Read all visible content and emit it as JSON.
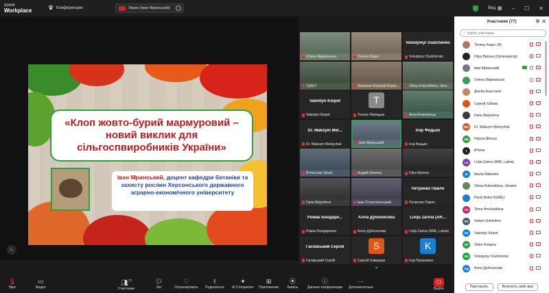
{
  "titlebar": {
    "logo_line1": "zoom",
    "logo_line2": "Workplace",
    "meeting_label": "Конференции",
    "share_label": "Экран (Іван Мринський)",
    "view_label": "Вид"
  },
  "slide": {
    "title": "«Клоп жовто-бурий мармуровий – новий виклик для сільгоспвиробників України»",
    "author_name": "Іван Мринський",
    "author_rest": ", доцент кафедри ботаніки та захисту рослин Херсонського державного аграрно-економічного університету"
  },
  "gallery": [
    {
      "big": "",
      "name": "Олена Марковська",
      "bg": "#6b7e6a"
    },
    {
      "big": "",
      "name": "Тетяна Ходос",
      "bg": "#8a7a6a"
    },
    {
      "big": "Volodymyr Dudchenko",
      "name": "Volodymyr Dudchenko",
      "bg": "#262626"
    },
    {
      "big": "",
      "name": "ГДАЕУ",
      "bg": "#4a5b4a"
    },
    {
      "big": "",
      "name": "Левченко Валерій Борис...",
      "bg": "#7a6b5a"
    },
    {
      "big": "",
      "name": "Olena Kokovikhina, Ukra...",
      "bg": "#5a6a5a"
    },
    {
      "big": "Valentyn Klopot",
      "name": "Valentyn Klopot",
      "bg": "#262626"
    },
    {
      "big": "",
      "name": "Тетяна Лапицька",
      "bg": "#262626",
      "letter": "T",
      "sqcolor": "#8a8a8a"
    },
    {
      "big": "",
      "name": "Анна Компанієць",
      "bg": "#4a6a5a"
    },
    {
      "big": "Dr. Maksym Mel...",
      "name": "Dr. Maksym Melnychuk",
      "bg": "#262626"
    },
    {
      "big": "",
      "name": "Іван Мринський",
      "bg": "#5a6a7a",
      "active": true
    },
    {
      "big": "Ігор Федько",
      "name": "Ігор Федько",
      "bg": "#262626"
    },
    {
      "big": "",
      "name": "В'ячеслав Урсал",
      "bg": "#4a5a6a"
    },
    {
      "big": "",
      "name": "Андрій Шепель",
      "bg": "#5a5a5a"
    },
    {
      "big": "",
      "name": "Dilya Bykova",
      "bg": "#2a2a2a"
    },
    {
      "big": "",
      "name": "Daria Balysheva",
      "bg": "#3a3a3a"
    },
    {
      "big": "",
      "name": "Іван Остропольський",
      "bg": "#4a4a5a"
    },
    {
      "big": "Петренко Павло",
      "name": "Петренко Павло",
      "bg": "#262626"
    },
    {
      "big": "Роман Бондаре...",
      "name": "Роман Бондаренко",
      "bg": "#262626"
    },
    {
      "big": "Алла Дубоносова",
      "name": "Алла Дубоносова",
      "bg": "#262626"
    },
    {
      "big": "Livija Zarina (AR...",
      "name": "Livija Zarina (ARE, Latvia)",
      "bg": "#262626"
    },
    {
      "big": "Гасовський Сергій",
      "name": "Гасовський Сергій",
      "bg": "#262626"
    },
    {
      "big": "",
      "name": "Сергей Скворцов",
      "bg": "#262626",
      "letter": "S",
      "sqcolor": "#e0541a"
    },
    {
      "big": "",
      "name": "Ігор Паланичко",
      "bg": "#262626",
      "letter": "K",
      "sqcolor": "#1a7fd0"
    }
  ],
  "panel": {
    "title": "Участники (77)",
    "search_placeholder": "Найти участника",
    "invite_label": "Пригласить",
    "unmute_label": "Включить свой звук",
    "participants": [
      {
        "name": "Тетяна Ходос (Я)",
        "color": "#b07a5a",
        "initials": "",
        "mic_on": false,
        "cam_on": false
      },
      {
        "name": "Dilya Bykova (Организатор)",
        "color": "#222222",
        "initials": "",
        "mic_on": false,
        "cam_on": false
      },
      {
        "name": "Іван Мринський",
        "color": "#6a7a8a",
        "initials": "",
        "mic_on": true,
        "cam_on": false,
        "sharing": true
      },
      {
        "name": "Олена Марковська",
        "color": "#3a9a5a",
        "initials": "",
        "mic_on": true,
        "cam_on": false
      },
      {
        "name": "Дзюба Анастасія",
        "color": "#c08a6a",
        "initials": "",
        "mic_on": false,
        "cam_on": false
      },
      {
        "name": "Сергей Хаблак",
        "color": "#e0541a",
        "initials": "",
        "mic_on": false,
        "cam_on": false
      },
      {
        "name": "Daria Balysheva",
        "color": "#3a3a3a",
        "initials": "",
        "mic_on": false,
        "cam_on": false
      },
      {
        "name": "Dr. Maksym Melnychuk",
        "color": "#e0541a",
        "initials": "DM",
        "mic_on": false,
        "cam_on": false
      },
      {
        "name": "Halyna Bilovus",
        "color": "#2ea043",
        "initials": "HB",
        "mic_on": false,
        "cam_on": false
      },
      {
        "name": "iPhone",
        "color": "#222222",
        "initials": "I",
        "mic_on": false,
        "cam_on": false
      },
      {
        "name": "Livija Zarina (ARE, Latvia)",
        "color": "#7a3ab0",
        "initials": "LZ",
        "mic_on": false,
        "cam_on": false
      },
      {
        "name": "Mariia Nikitenko",
        "color": "#1a7fd0",
        "initials": "M",
        "mic_on": false,
        "cam_on": false
      },
      {
        "name": "Olena Kokovikhina, Ukraine",
        "color": "#5a8a5a",
        "initials": "",
        "mic_on": false,
        "cam_on": false
      },
      {
        "name": "Pavlo Boiko KSAEU",
        "color": "#1a7fd0",
        "initials": "",
        "mic_on": false,
        "cam_on": false
      },
      {
        "name": "Toma Hrechishkina",
        "color": "#c02a6a",
        "initials": "TH",
        "mic_on": false,
        "cam_on": false
      },
      {
        "name": "Vadym Gololobov",
        "color": "#4a5a6a",
        "initials": "VG",
        "mic_on": false,
        "cam_on": false
      },
      {
        "name": "Valentyn Klopot",
        "color": "#1a7fd0",
        "initials": "VK",
        "mic_on": false,
        "cam_on": false
      },
      {
        "name": "Viktor Potapov",
        "color": "#2ea043",
        "initials": "VP",
        "mic_on": false,
        "cam_on": false
      },
      {
        "name": "Volodymyr Dudchenko",
        "color": "#2ea043",
        "initials": "VD",
        "mic_on": false,
        "cam_on": false
      },
      {
        "name": "Алла Дубоносова",
        "color": "#1a7fd0",
        "initials": "АД",
        "mic_on": false,
        "cam_on": false
      }
    ]
  },
  "toolbar": {
    "audio": "Звук",
    "video": "Видео",
    "participants": "Участники",
    "participants_count": "77",
    "chat": "Чат",
    "react": "Отреагировать",
    "share": "Поделиться",
    "ai": "AI Companion",
    "apps": "Приложения",
    "record": "Запись",
    "info": "Данные конференции",
    "more": "Дополнительно",
    "leave": "Выйти"
  },
  "colors": {
    "accent_green": "#2ea043",
    "title_red": "#c21a1a",
    "subtitle_blue": "#1b3fa8",
    "muted_red": "#dd3333"
  }
}
